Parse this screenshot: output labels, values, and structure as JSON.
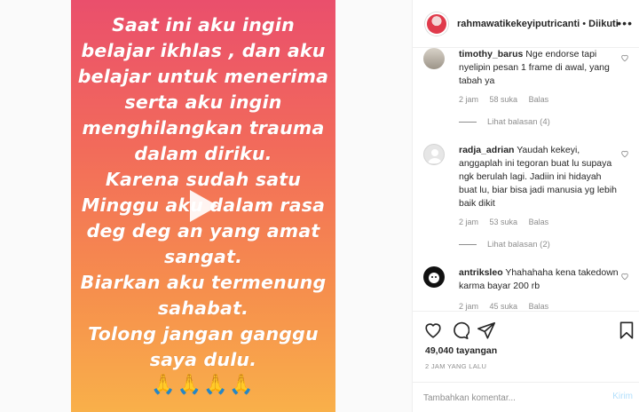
{
  "story": {
    "lines": [
      "Saat ini aku ingin",
      "belajar ikhlas , dan aku",
      "belajar untuk menerima",
      "serta aku ingin",
      "menghilangkan trauma",
      "dalam diriku.",
      "Karena sudah satu",
      "Minggu aku dalam rasa",
      "deg deg an yang amat",
      "sangat.",
      "Biarkan aku termenung",
      "sahabat.",
      "Tolong jangan ganggu",
      "saya dulu."
    ],
    "emoji": "🙏🙏🙏🙏",
    "gradient_top": "#ea4f6c",
    "gradient_bottom": "#f9b04a",
    "play_icon": "play-icon"
  },
  "header": {
    "username": "rahmawatikekeyiputricanti",
    "separator": "•",
    "follow_status": "Diikuti",
    "more_icon": "more-options-icon"
  },
  "comments": [
    {
      "user": "timothy_barus",
      "text": "Nge endorse tapi nyelipin pesan 1 frame di awal, yang tabah ya",
      "time": "2 jam",
      "likes": "58 suka",
      "reply": "Balas",
      "view_replies": "Lihat balasan (4)"
    },
    {
      "user": "radja_adrian",
      "text": "Yaudah kekeyi, anggaplah ini tegoran buat lu supaya ngk berulah lagi. Jadiin ini hidayah buat lu, biar bisa jadi manusia yg lebih baik dikit",
      "time": "2 jam",
      "likes": "53 suka",
      "reply": "Balas",
      "view_replies": "Lihat balasan (2)"
    },
    {
      "user": "antriksleo",
      "text": "Yhahahaha kena takedown karma bayar 200 rb",
      "time": "2 jam",
      "likes": "45 suka",
      "reply": "Balas"
    }
  ],
  "actions": {
    "views": "49,040 tayangan",
    "posted": "2 JAM YANG LALU"
  },
  "add_comment": {
    "placeholder": "Tambahkan komentar...",
    "post_label": "Kirim"
  },
  "colors": {
    "link_disabled": "#b2dffc",
    "muted_text": "#8e8e8e",
    "primary_text": "#262626"
  }
}
